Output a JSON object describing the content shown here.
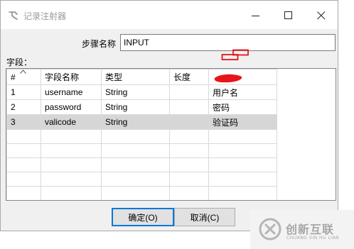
{
  "window": {
    "title": "记录注射器",
    "icon": "injector-icon",
    "controls": {
      "minimize": "minimize-icon",
      "maximize": "maximize-icon",
      "close": "close-icon"
    }
  },
  "step": {
    "label": "步骤名称",
    "value": "INPUT"
  },
  "fields": {
    "label": "字段：",
    "columns": [
      "#",
      "字段名称",
      "类型",
      "长度",
      ""
    ],
    "rows": [
      {
        "num": "1",
        "name": "username",
        "type": "String",
        "length": "",
        "comment": "用户名"
      },
      {
        "num": "2",
        "name": "password",
        "type": "String",
        "length": "",
        "comment": "密码"
      },
      {
        "num": "3",
        "name": "valicode",
        "type": "String",
        "length": "",
        "comment": "验证码"
      }
    ],
    "selected_row": 3
  },
  "buttons": {
    "ok": "确定(O)",
    "cancel": "取消(C)"
  },
  "watermark": {
    "text": "创新互联",
    "sub": "CHUANG XIN HU LIAN"
  },
  "colors": {
    "annotation_red": "#e8141b",
    "selection": "#d6d6d6",
    "focus_border": "#0078d7"
  }
}
